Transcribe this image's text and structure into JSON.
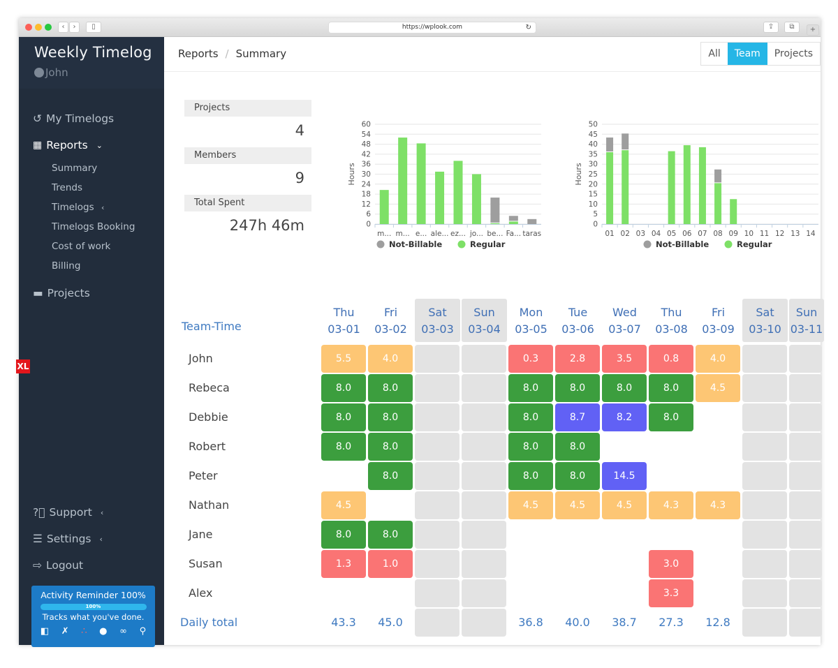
{
  "browser": {
    "url": "https://wplook.com",
    "back_icon": "‹",
    "forward_icon": "›"
  },
  "sidebar": {
    "app_title": "Weekly Timelog",
    "user": "John",
    "items": [
      {
        "label": "My Timelogs",
        "icon": "history-icon"
      },
      {
        "label": "Reports",
        "icon": "grid-icon"
      }
    ],
    "reports_sub": [
      "Summary",
      "Trends",
      "Timelogs",
      "Timelogs Booking",
      "Cost of work",
      "Billing"
    ],
    "projects_label": "Projects",
    "support_label": "Support",
    "settings_label": "Settings",
    "logout_label": "Logout",
    "reminder": {
      "title": "Activity Reminder 100%",
      "progress_percent": 100,
      "progress_label": "100%",
      "subtitle": "Tracks what you've done."
    },
    "xl_badge": "XL"
  },
  "header": {
    "breadcrumb": [
      "Reports",
      "Summary"
    ],
    "toggle": [
      "All",
      "Team",
      "Projects"
    ],
    "toggle_active": "Team"
  },
  "stats": {
    "projects_label": "Projects",
    "projects_value": "4",
    "members_label": "Members",
    "members_value": "9",
    "total_label": "Total Spent",
    "total_value": "247h 46m"
  },
  "chart_data": [
    {
      "type": "bar",
      "stacked": true,
      "title": "",
      "xlabel": "",
      "ylabel": "Hours",
      "ylim": [
        0,
        60
      ],
      "yticks": [
        0,
        6,
        12,
        18,
        24,
        30,
        36,
        42,
        48,
        54,
        60
      ],
      "categories": [
        "m...",
        "m...",
        "e...",
        "ale...",
        "ez...",
        "jo...",
        "be...",
        "Fa...",
        "taras"
      ],
      "series": [
        {
          "name": "Regular",
          "color": "#7ee067",
          "values": [
            20.5,
            52,
            48.5,
            31.5,
            38,
            30,
            0.5,
            1.5,
            0
          ]
        },
        {
          "name": "Not-Billable",
          "color": "#9e9e9e",
          "values": [
            0,
            0,
            0,
            0,
            0,
            0,
            15,
            3,
            3
          ]
        }
      ],
      "legend": [
        "Not-Billable",
        "Regular"
      ],
      "legend_position": "bottom",
      "grid": true
    },
    {
      "type": "bar",
      "stacked": true,
      "title": "",
      "xlabel": "",
      "ylabel": "Hours",
      "ylim": [
        0,
        50
      ],
      "yticks": [
        0,
        5,
        10,
        15,
        20,
        25,
        30,
        35,
        40,
        45,
        50
      ],
      "categories": [
        "01",
        "02",
        "03",
        "04",
        "05",
        "06",
        "07",
        "08",
        "09",
        "10",
        "11",
        "12",
        "13",
        "14"
      ],
      "series": [
        {
          "name": "Regular",
          "color": "#7ee067",
          "values": [
            36,
            37,
            0,
            0,
            36.5,
            39.5,
            38.5,
            20.5,
            12.5,
            0,
            0,
            0,
            0,
            0
          ]
        },
        {
          "name": "Not-Billable",
          "color": "#9e9e9e",
          "values": [
            7,
            8,
            0,
            0,
            0,
            0,
            0,
            6.5,
            0,
            0,
            0,
            0,
            0,
            0
          ]
        }
      ],
      "legend": [
        "Not-Billable",
        "Regular"
      ],
      "legend_position": "bottom",
      "grid": true
    }
  ],
  "team_time": {
    "title": "Team-Time",
    "total_label": "Daily total",
    "days": [
      {
        "dow": "Thu",
        "date": "03-01",
        "weekend": false
      },
      {
        "dow": "Fri",
        "date": "03-02",
        "weekend": false
      },
      {
        "dow": "Sat",
        "date": "03-03",
        "weekend": true
      },
      {
        "dow": "Sun",
        "date": "03-04",
        "weekend": true
      },
      {
        "dow": "Mon",
        "date": "03-05",
        "weekend": false
      },
      {
        "dow": "Tue",
        "date": "03-06",
        "weekend": false
      },
      {
        "dow": "Wed",
        "date": "03-07",
        "weekend": false
      },
      {
        "dow": "Thu",
        "date": "03-08",
        "weekend": false
      },
      {
        "dow": "Fri",
        "date": "03-09",
        "weekend": false
      },
      {
        "dow": "Sat",
        "date": "03-10",
        "weekend": true
      },
      {
        "dow": "Sun",
        "date": "03-11",
        "weekend": true
      }
    ],
    "colors": {
      "under": "#fdc674",
      "low": "#fa7474",
      "full": "#3c9e3e",
      "over": "#6161f5",
      "weekend": "#e3e3e3"
    },
    "rows": [
      {
        "name": "John",
        "cells": [
          [
            "5.5",
            "under"
          ],
          [
            "4.0",
            "under"
          ],
          null,
          null,
          [
            "0.3",
            "low"
          ],
          [
            "2.8",
            "low"
          ],
          [
            "3.5",
            "low"
          ],
          [
            "0.8",
            "low"
          ],
          [
            "4.0",
            "under"
          ],
          null,
          null
        ]
      },
      {
        "name": "Rebeca",
        "cells": [
          [
            "8.0",
            "full"
          ],
          [
            "8.0",
            "full"
          ],
          null,
          null,
          [
            "8.0",
            "full"
          ],
          [
            "8.0",
            "full"
          ],
          [
            "8.0",
            "full"
          ],
          [
            "8.0",
            "full"
          ],
          [
            "4.5",
            "under"
          ],
          null,
          null
        ]
      },
      {
        "name": "Debbie",
        "cells": [
          [
            "8.0",
            "full"
          ],
          [
            "8.0",
            "full"
          ],
          null,
          null,
          [
            "8.0",
            "full"
          ],
          [
            "8.7",
            "over"
          ],
          [
            "8.2",
            "over"
          ],
          [
            "8.0",
            "full"
          ],
          null,
          null,
          null
        ]
      },
      {
        "name": "Robert",
        "cells": [
          [
            "8.0",
            "full"
          ],
          [
            "8.0",
            "full"
          ],
          null,
          null,
          [
            "8.0",
            "full"
          ],
          [
            "8.0",
            "full"
          ],
          null,
          null,
          null,
          null,
          null
        ]
      },
      {
        "name": "Peter",
        "cells": [
          null,
          [
            "8.0",
            "full"
          ],
          null,
          null,
          [
            "8.0",
            "full"
          ],
          [
            "8.0",
            "full"
          ],
          [
            "14.5",
            "over"
          ],
          null,
          null,
          null,
          null
        ]
      },
      {
        "name": "Nathan",
        "cells": [
          [
            "4.5",
            "under"
          ],
          null,
          null,
          null,
          [
            "4.5",
            "under"
          ],
          [
            "4.5",
            "under"
          ],
          [
            "4.5",
            "under"
          ],
          [
            "4.3",
            "under"
          ],
          [
            "4.3",
            "under"
          ],
          null,
          null
        ]
      },
      {
        "name": "Jane",
        "cells": [
          [
            "8.0",
            "full"
          ],
          [
            "8.0",
            "full"
          ],
          null,
          null,
          null,
          null,
          null,
          null,
          null,
          null,
          null
        ]
      },
      {
        "name": "Susan",
        "cells": [
          [
            "1.3",
            "low"
          ],
          [
            "1.0",
            "low"
          ],
          null,
          null,
          null,
          null,
          null,
          [
            "3.0",
            "low"
          ],
          null,
          null,
          null
        ]
      },
      {
        "name": "Alex",
        "cells": [
          null,
          null,
          null,
          null,
          null,
          null,
          null,
          [
            "3.3",
            "low"
          ],
          null,
          null,
          null
        ]
      }
    ],
    "totals": [
      "43.3",
      "45.0",
      "",
      "",
      "36.8",
      "40.0",
      "38.7",
      "27.3",
      "12.8",
      "",
      ""
    ]
  }
}
